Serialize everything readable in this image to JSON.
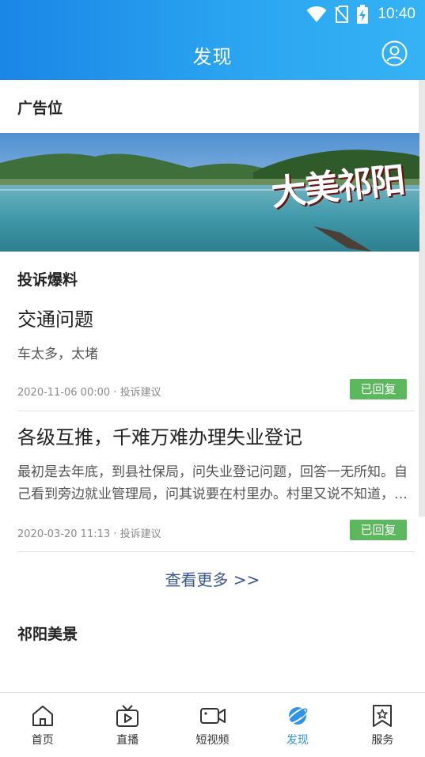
{
  "status_bar": {
    "time": "10:40",
    "icons": [
      "wifi-icon",
      "no-sim-icon",
      "battery-charging-icon"
    ]
  },
  "header": {
    "title": "发现",
    "profile_icon": "user-circle-icon"
  },
  "ad_section": {
    "title": "广告位",
    "banner_text": "大美祁阳"
  },
  "complaints": {
    "title": "投诉爆料",
    "items": [
      {
        "title": "交通问题",
        "desc": "车太多，太堵",
        "date": "2020-11-06 00:00",
        "category": "投诉建议",
        "status": "已回复"
      },
      {
        "title": "各级互推，千难万难办理失业登记",
        "desc": "最初是去年底，到县社保局，问失业登记问题，回答一无所知。自己看到旁边就业管理局，问其说要在村里办。村里又说不知道，到处推来推去，至今没有办成。",
        "date": "2020-03-20 11:13",
        "category": "投诉建议",
        "status": "已回复"
      }
    ],
    "more_link": "查看更多 >>"
  },
  "scenery": {
    "title": "祁阳美景"
  },
  "tabbar": {
    "tabs": [
      {
        "label": "首页",
        "icon": "home-icon"
      },
      {
        "label": "直播",
        "icon": "tv-icon"
      },
      {
        "label": "短视频",
        "icon": "video-camera-icon"
      },
      {
        "label": "发现",
        "icon": "planet-icon",
        "active": true
      },
      {
        "label": "服务",
        "icon": "bookmark-star-icon"
      }
    ]
  },
  "colors": {
    "header_start": "#1a86e6",
    "header_end": "#35b3f5",
    "badge_green": "#5cb85c",
    "active_tab": "#2f93ea",
    "link": "#3a5795"
  }
}
